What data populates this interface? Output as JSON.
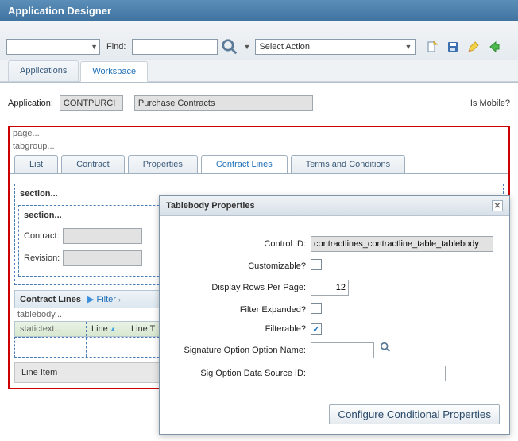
{
  "title": "Application Designer",
  "navbar": {
    "find_label": "Find:",
    "find_value": "",
    "action_placeholder": "Select Action"
  },
  "main_tabs": {
    "applications": "Applications",
    "workspace": "Workspace"
  },
  "workspace": {
    "app_label": "Application:",
    "app_value": "CONTPURCI",
    "app_desc": "Purchase Contracts",
    "is_mobile_label": "Is Mobile?"
  },
  "canvas": {
    "page_label": "page...",
    "tabgroup_label": "tabgroup...",
    "tabs": {
      "list": "List",
      "contract": "Contract",
      "properties": "Properties",
      "contract_lines": "Contract Lines",
      "terms": "Terms and Conditions"
    },
    "section_label": "section...",
    "contract_label": "Contract:",
    "revision_label": "Revision:",
    "cl_title": "Contract Lines",
    "filter_label": "Filter",
    "tablebody_label": "tablebody...",
    "statictext_label": "statictext...",
    "col_line": "Line",
    "col_linet": "Line T",
    "line_item": "Line Item"
  },
  "dialog": {
    "title": "Tablebody Properties",
    "control_id_label": "Control ID:",
    "control_id_value": "contractlines_contractline_table_tablebody",
    "customizable_label": "Customizable?",
    "customizable": false,
    "rows_label": "Display Rows Per Page:",
    "rows_value": "12",
    "filter_expanded_label": "Filter Expanded?",
    "filter_expanded": false,
    "filterable_label": "Filterable?",
    "filterable": true,
    "sig_name_label": "Signature Option Option Name:",
    "sig_name_value": "",
    "sig_src_label": "Sig Option Data Source ID:",
    "sig_src_value": "",
    "config_btn": "Configure Conditional Properties"
  }
}
